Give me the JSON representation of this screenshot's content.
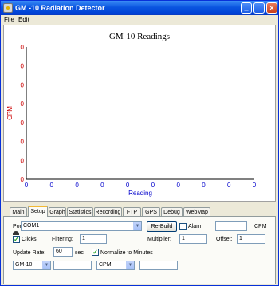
{
  "window": {
    "title": "GM -10 Radiation Detector",
    "controls": {
      "minimize": "_",
      "maximize": "□",
      "close": "×"
    }
  },
  "menu": [
    "File",
    "Edit"
  ],
  "chart_data": {
    "type": "line",
    "title": "GM-10 Readings",
    "xlabel": "Reading",
    "ylabel": "CPM",
    "x_ticks": [
      "0",
      "0",
      "0",
      "0",
      "0",
      "0",
      "0",
      "0",
      "0",
      "0"
    ],
    "y_ticks": [
      "0",
      "0",
      "0",
      "0",
      "0",
      "0",
      "0",
      "0"
    ],
    "grid": false,
    "series": []
  },
  "tabs": [
    "Main",
    "Setup",
    "Graph",
    "Statistics",
    "Recording",
    "FTP",
    "GPS",
    "Debug",
    "WebMap"
  ],
  "active_tab": "Setup",
  "setup": {
    "port_label": "Port:",
    "port_value": "COM1",
    "rebuild_label": "Re-Build",
    "alarm_label": "Alarm",
    "alarm_checked": false,
    "alarm_value": "",
    "cpm_unit": "CPM",
    "clicks_label": "Clicks",
    "clicks_checked": true,
    "filtering_label": "Filtering:",
    "filtering_value": "1",
    "multiplier_label": "Multiplier:",
    "multiplier_value": "1",
    "offset_label": "Offset:",
    "offset_value": "1",
    "update_rate_label": "Update Rate:",
    "update_rate_value": "60",
    "sec_label": "sec",
    "normalize_label": "Normalize to Minutes",
    "normalize_checked": true,
    "device_value": "GM-10",
    "device_text": "",
    "unit_value": "CPM",
    "unit_text": ""
  }
}
